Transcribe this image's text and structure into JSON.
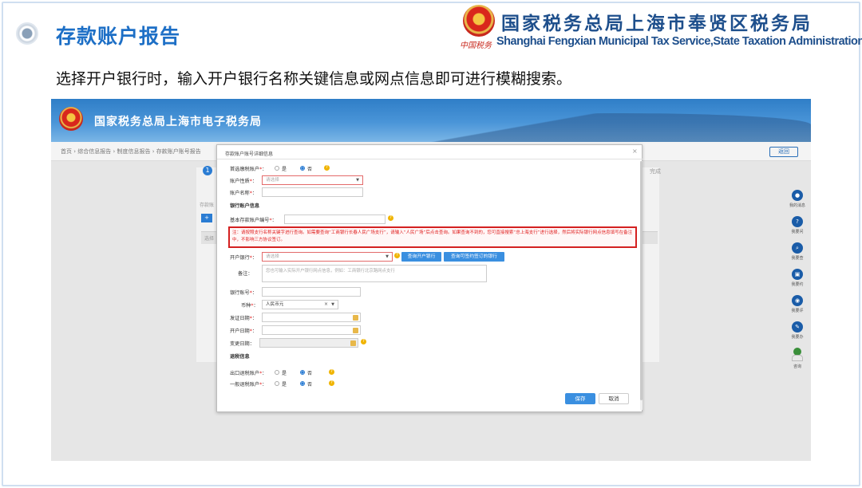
{
  "slide": {
    "title": "存款账户报告",
    "subtitle": "选择开户银行时，输入开户银行名称关键信息或网点信息即可进行模糊搜索。"
  },
  "brand": {
    "cn": "国家税务总局上海市奉贤区税务局",
    "en": "Shanghai Fengxian Municipal Tax Service,State Taxation Administration",
    "emblem_caption": "中国税务"
  },
  "app": {
    "banner_title": "国家税务总局上海市电子税务局",
    "breadcrumb": "首页  ›  综合信息报告  ›  制度信息报告  ›  存款账户账号报告",
    "back_label": "返回",
    "step_number": "1",
    "step_done_label": "完成",
    "bg_section_label": "存款账",
    "bg_add_label": "+",
    "bg_table_col": "选择"
  },
  "right_rail": [
    {
      "icon": "message-icon",
      "label": "我的消息",
      "glyph": "●"
    },
    {
      "icon": "question-icon",
      "label": "我要问",
      "glyph": "?"
    },
    {
      "icon": "search-icon",
      "label": "我要查",
      "glyph": "⌕"
    },
    {
      "icon": "calendar-icon",
      "label": "我要约",
      "glyph": "▣"
    },
    {
      "icon": "rate-icon",
      "label": "我要评",
      "glyph": "◉"
    },
    {
      "icon": "edit-icon",
      "label": "我要办",
      "glyph": "✎"
    }
  ],
  "rail_avatar_label": "咨询",
  "modal": {
    "title": "存款账户账号详细信息",
    "close": "×",
    "fields": {
      "is_primary_label": "首选缴税账户",
      "yes": "是",
      "no": "否",
      "account_nature_label": "账户性质",
      "account_nature_placeholder": "请选择",
      "account_name_label": "账户名称",
      "section_bank": "银行账户信息",
      "basic_account_label": "基本存款账户编号",
      "notice": "注：请按照支行名称关键字进行查询。如需要查询“工商银行长春人民广场支行”，请输入“人民广场”后点击查询。如果查询不到的，您可直接搜索“总上海支行”进行选择，然后将实际银行网点信息填写在备注中，不影响三方协议签订。",
      "open_bank_label": "开户银行",
      "open_bank_placeholder": "请选择",
      "btn_query_bank": "查询开户银行",
      "btn_query_signed": "查询可签约签订的银行",
      "remark_label": "备注",
      "remark_placeholder": "您也可输入实际开户银行网点信息，例如：工商银行北京路网点支行",
      "bank_account_label": "银行账号",
      "currency_label": "币种",
      "currency_value": "人民币元",
      "issue_date_label": "发证日期",
      "open_date_label": "开户日期",
      "change_date_label": "变更日期",
      "section_refund": "退税信息",
      "export_refund_label": "出口退税账户",
      "general_refund_label": "一般退税账户"
    },
    "save": "保存",
    "cancel": "取消"
  },
  "colors": {
    "title_blue": "#1d6fc6",
    "brand_navy": "#1e4f8c",
    "notice_red": "#d42020",
    "button_blue": "#3a8fe0"
  }
}
